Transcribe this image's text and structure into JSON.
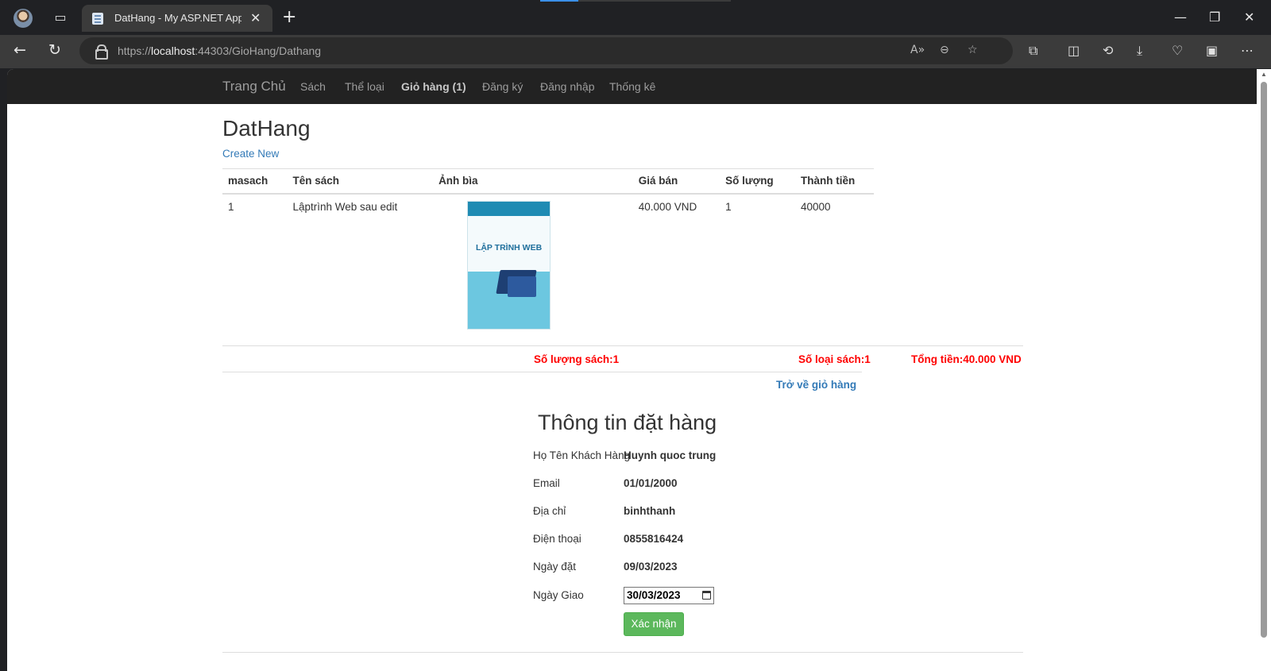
{
  "browser": {
    "tab_title": "DatHang - My ASP.NET Applic",
    "url_host_prefix": "https://",
    "url_host": "localhost",
    "url_rest": ":44303/GioHang/Dathang",
    "tab_close": "✕",
    "new_tab": "+",
    "window_controls": [
      "—",
      "❐",
      "✕"
    ]
  },
  "navbar": {
    "brand": "Trang Chủ",
    "links": [
      "Sách",
      "Thể loại",
      "Giỏ hàng (1)",
      "Đăng ký",
      "Đăng nhập",
      "Thống kê"
    ]
  },
  "page": {
    "title": "DatHang",
    "create_new": "Create New"
  },
  "table": {
    "headers": [
      "masach",
      "Tên sách",
      "Ảnh bìa",
      "Giá bán",
      "Số lượng",
      "Thành tiền"
    ],
    "rows": [
      {
        "masach": "1",
        "ten_sach": "Lậptrình Web sau edit",
        "cover_title": "LẬP TRÌNH WEB",
        "gia_ban": "40.000 VND",
        "so_luong": "1",
        "thanh_tien": "40000"
      }
    ]
  },
  "totals": {
    "so_luong_sach": "Số lượng sách:1",
    "so_loai_sach": "Số loại sách:1",
    "tong_tien": "Tổng tiền:40.000 VND"
  },
  "back_link": "Trở về giỏ hàng",
  "order_info": {
    "heading": "Thông tin đặt hàng",
    "fields": [
      {
        "label": "Họ Tên Khách Hàng",
        "value": "Huynh quoc trung"
      },
      {
        "label": "Email",
        "value": "01/01/2000"
      },
      {
        "label": "Địa chỉ",
        "value": "binhthanh"
      },
      {
        "label": "Điện thoại",
        "value": "0855816424"
      },
      {
        "label": "Ngày đặt",
        "value": "09/03/2023"
      }
    ],
    "delivery_label": "Ngày Giao",
    "delivery_value": "30/03/2023",
    "submit_label": "Xác nhận"
  },
  "colors": {
    "navbar_bg": "#222222",
    "link": "#337ab7",
    "total_red": "#ff0000",
    "submit_green": "#5cb85c"
  }
}
